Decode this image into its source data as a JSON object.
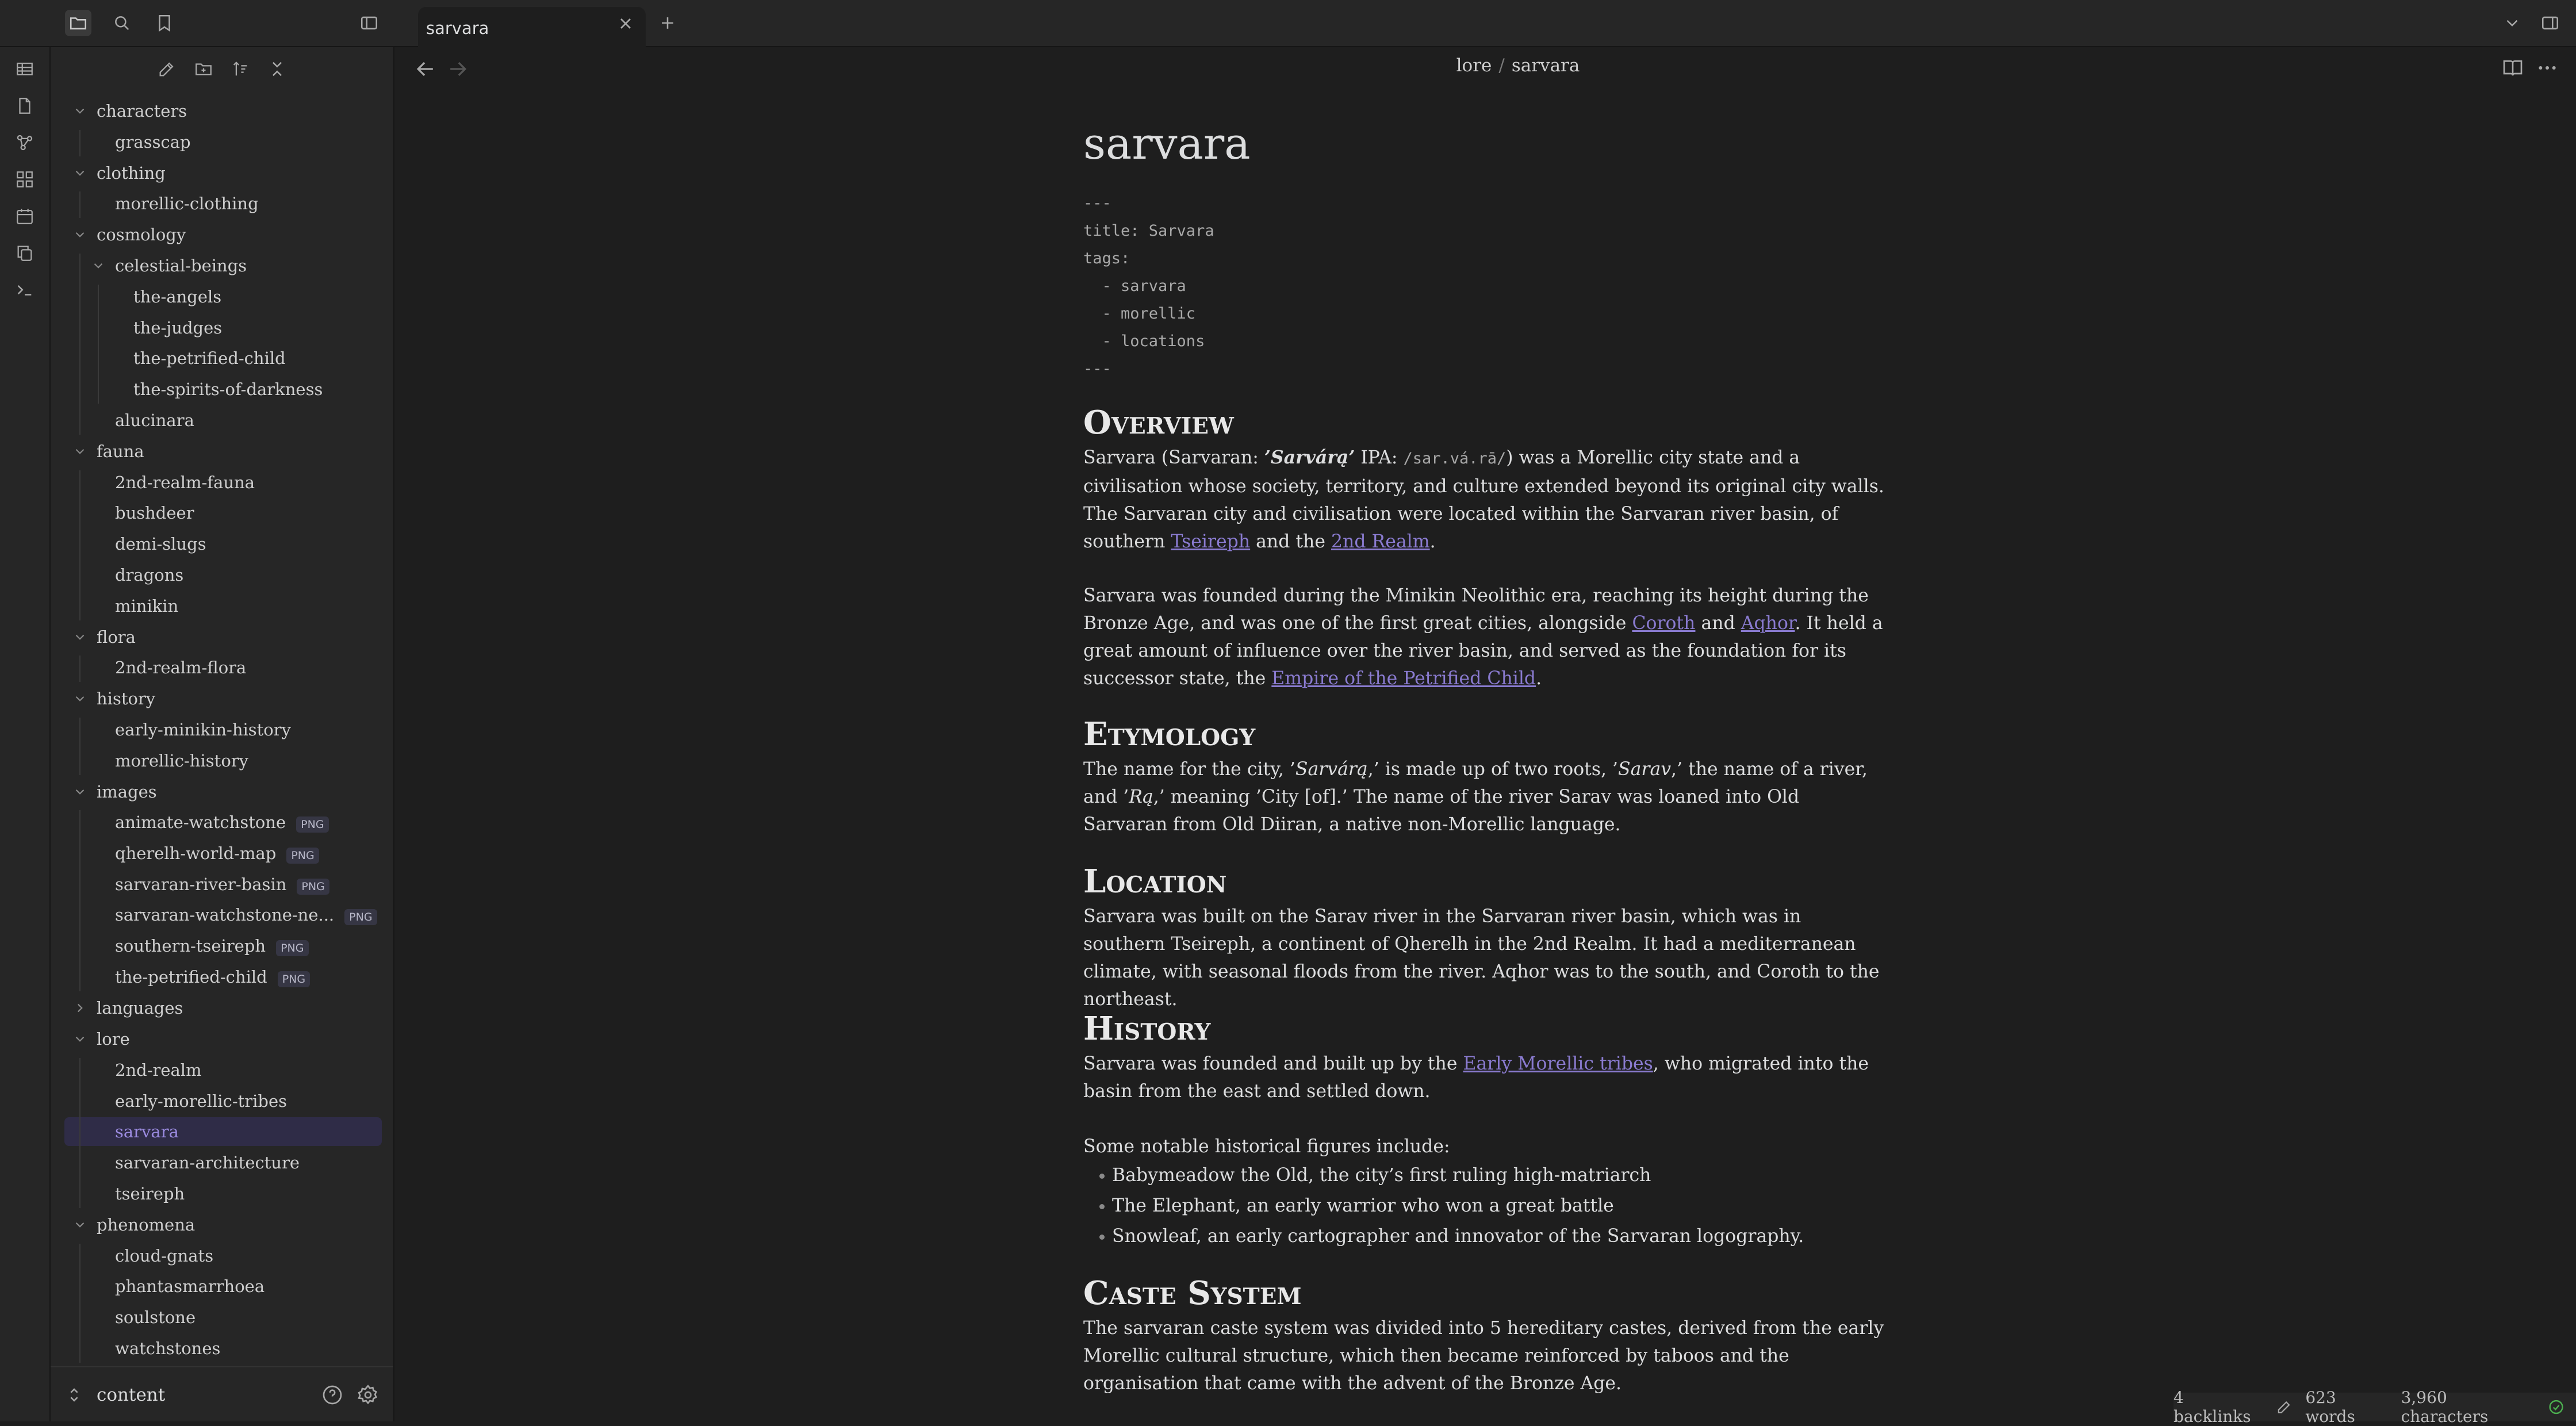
{
  "tab": {
    "title": "sarvara"
  },
  "breadcrumb": {
    "folder": "lore",
    "separator": "/",
    "file": "sarvara"
  },
  "vault": {
    "name": "content"
  },
  "tree": [
    {
      "label": "characters",
      "depth": 0,
      "folder": true,
      "open": true
    },
    {
      "label": "grasscap",
      "depth": 1
    },
    {
      "label": "clothing",
      "depth": 0,
      "folder": true,
      "open": true
    },
    {
      "label": "morellic-clothing",
      "depth": 1
    },
    {
      "label": "cosmology",
      "depth": 0,
      "folder": true,
      "open": true
    },
    {
      "label": "celestial-beings",
      "depth": 1,
      "folder": true,
      "open": true
    },
    {
      "label": "the-angels",
      "depth": 2
    },
    {
      "label": "the-judges",
      "depth": 2
    },
    {
      "label": "the-petrified-child",
      "depth": 2
    },
    {
      "label": "the-spirits-of-darkness",
      "depth": 2
    },
    {
      "label": "alucinara",
      "depth": 1
    },
    {
      "label": "fauna",
      "depth": 0,
      "folder": true,
      "open": true
    },
    {
      "label": "2nd-realm-fauna",
      "depth": 1
    },
    {
      "label": "bushdeer",
      "depth": 1
    },
    {
      "label": "demi-slugs",
      "depth": 1
    },
    {
      "label": "dragons",
      "depth": 1
    },
    {
      "label": "minikin",
      "depth": 1
    },
    {
      "label": "flora",
      "depth": 0,
      "folder": true,
      "open": true
    },
    {
      "label": "2nd-realm-flora",
      "depth": 1
    },
    {
      "label": "history",
      "depth": 0,
      "folder": true,
      "open": true
    },
    {
      "label": "early-minikin-history",
      "depth": 1
    },
    {
      "label": "morellic-history",
      "depth": 1
    },
    {
      "label": "images",
      "depth": 0,
      "folder": true,
      "open": true
    },
    {
      "label": "animate-watchstone",
      "depth": 1,
      "badge": "PNG"
    },
    {
      "label": "qherelh-world-map",
      "depth": 1,
      "badge": "PNG"
    },
    {
      "label": "sarvaran-river-basin",
      "depth": 1,
      "badge": "PNG"
    },
    {
      "label": "sarvaran-watchstone-ne...",
      "depth": 1,
      "badge": "PNG"
    },
    {
      "label": "southern-tseireph",
      "depth": 1,
      "badge": "PNG"
    },
    {
      "label": "the-petrified-child",
      "depth": 1,
      "badge": "PNG"
    },
    {
      "label": "languages",
      "depth": 0,
      "folder": true,
      "open": false
    },
    {
      "label": "lore",
      "depth": 0,
      "folder": true,
      "open": true
    },
    {
      "label": "2nd-realm",
      "depth": 1
    },
    {
      "label": "early-morellic-tribes",
      "depth": 1
    },
    {
      "label": "sarvara",
      "depth": 1,
      "active": true
    },
    {
      "label": "sarvaran-architecture",
      "depth": 1
    },
    {
      "label": "tseireph",
      "depth": 1
    },
    {
      "label": "phenomena",
      "depth": 0,
      "folder": true,
      "open": true
    },
    {
      "label": "cloud-gnats",
      "depth": 1
    },
    {
      "label": "phantasmarrhoea",
      "depth": 1
    },
    {
      "label": "soulstone",
      "depth": 1
    },
    {
      "label": "watchstones",
      "depth": 1
    }
  ],
  "doc": {
    "title": "sarvara",
    "frontmatter": "---\ntitle: Sarvara\ntags:\n  - sarvara\n  - morellic\n  - locations\n---",
    "h_overview": "Overview",
    "p1": {
      "t1": "Sarvara (Sarvaran: ",
      "native": "’Sarvárą’",
      "t2": " IPA: ",
      "ipa": "/sar.vá.rā/",
      "t3": ") was a Morellic city state and a civilisation whose society, territory, and culture extended beyond its original city walls. The Sarvaran city and civilisation were located within the Sarvaran river basin, of southern ",
      "link1": "Tseireph",
      "t4": " and the ",
      "link2": "2nd Realm",
      "t5": "."
    },
    "p2": {
      "t1": "Sarvara was founded during the Minikin Neolithic era, reaching its height during the Bronze Age, and was one of the first great cities, alongside ",
      "link1": "Coroth",
      "t2": " and ",
      "link2": "Aqhor",
      "t3": ". It held a great amount of influence over the river basin, and served as the foundation for its successor state, the ",
      "link3": "Empire of the Petrified Child",
      "t4": "."
    },
    "h_etymology": "Etymology",
    "p3": {
      "t1": "The name for the city, ’",
      "w1": "Sarvárą",
      "t2": ",’ is made up of two roots, ’",
      "w2": "Sarav",
      "t3": ",’ the name of a river, and ’",
      "w3": "Rą",
      "t4": ",’ meaning ’City [of].’ The name of the river Sarav was loaned into Old Sarvaran from Old Diiran, a native non-Morellic language."
    },
    "h_location": "Location",
    "p4": "Sarvara was built on the Sarav river in the Sarvaran river basin, which was in southern Tseireph, a continent of Qherelh in the 2nd Realm. It had a mediterranean climate, with seasonal floods from the river. Aqhor was to the south, and Coroth to the northeast.",
    "h_history": "History",
    "p5": {
      "t1": "Sarvara was founded and built up by the ",
      "link1": "Early Morellic tribes",
      "t2": ", who migrated into the basin from the east and settled down."
    },
    "p6": "Some notable historical figures include:",
    "figures": [
      "Babymeadow the Old, the city’s first ruling high-matriarch",
      "The Elephant, an early warrior who won a great battle",
      "Snowleaf, an early cartographer and innovator of the Sarvaran logography."
    ],
    "h_caste": "Caste System",
    "p7": "The sarvaran caste system was divided into 5 hereditary castes, derived from the early Morellic cultural structure, which then became reinforced by taboos and the organisation that came with the advent of the Bronze Age."
  },
  "status": {
    "backlinks": "4 backlinks",
    "words": "623 words",
    "chars": "3,960 characters"
  }
}
